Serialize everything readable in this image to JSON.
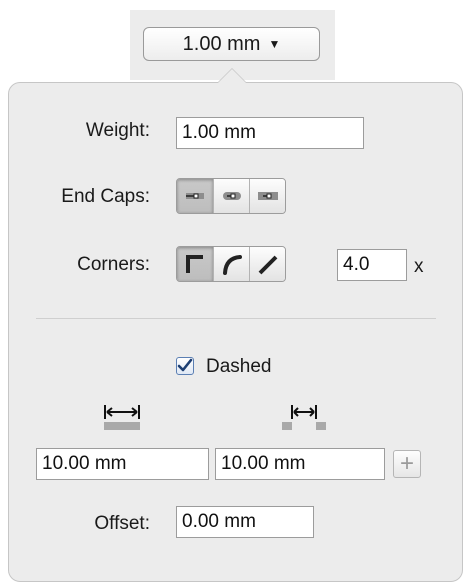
{
  "dropdown": {
    "value": "1.00 mm",
    "caret_icon": "caret-down-icon"
  },
  "weight": {
    "label": "Weight:",
    "value": "1.00 mm"
  },
  "end_caps": {
    "label": "End Caps:",
    "options": [
      "butt-cap-icon",
      "round-cap-icon",
      "projecting-cap-icon"
    ],
    "selected_index": 0
  },
  "corners": {
    "label": "Corners:",
    "options": [
      "miter-join-icon",
      "round-join-icon",
      "bevel-join-icon"
    ],
    "selected_index": 0,
    "miter_limit": "4.0",
    "miter_unit": "x"
  },
  "dashed": {
    "label": "Dashed",
    "checked": true
  },
  "dash": {
    "icon": "dash-length-icon",
    "value": "10.00 mm"
  },
  "gap": {
    "icon": "gap-length-icon",
    "value": "10.00 mm"
  },
  "add_button": {
    "icon": "plus-icon",
    "label": "+"
  },
  "offset": {
    "label": "Offset:",
    "value": "0.00 mm"
  }
}
